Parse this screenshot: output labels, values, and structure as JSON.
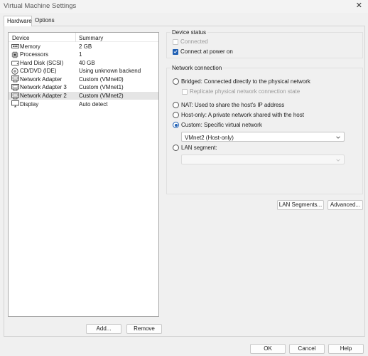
{
  "window": {
    "title": "Virtual Machine Settings",
    "close_glyph": "✕"
  },
  "tabs": [
    {
      "label": "Hardware",
      "active": true
    },
    {
      "label": "Options",
      "active": false
    }
  ],
  "device_list": {
    "headers": {
      "device": "Device",
      "summary": "Summary"
    },
    "rows": [
      {
        "icon": "memory-icon",
        "name": "Memory",
        "summary": "2 GB",
        "selected": false
      },
      {
        "icon": "processor-icon",
        "name": "Processors",
        "summary": "1",
        "selected": false
      },
      {
        "icon": "hard-disk-icon",
        "name": "Hard Disk (SCSI)",
        "summary": "40 GB",
        "selected": false
      },
      {
        "icon": "cd-dvd-icon",
        "name": "CD/DVD (IDE)",
        "summary": "Using unknown backend",
        "selected": false
      },
      {
        "icon": "network-adapter-icon",
        "name": "Network Adapter",
        "summary": "Custom (VMnet0)",
        "selected": false
      },
      {
        "icon": "network-adapter-icon",
        "name": "Network Adapter 3",
        "summary": "Custom (VMnet1)",
        "selected": false
      },
      {
        "icon": "network-adapter-icon",
        "name": "Network Adapter 2",
        "summary": "Custom (VMnet2)",
        "selected": true
      },
      {
        "icon": "display-icon",
        "name": "Display",
        "summary": "Auto detect",
        "selected": false
      }
    ],
    "add_label": "Add...",
    "remove_label": "Remove"
  },
  "device_status": {
    "title": "Device status",
    "connected": {
      "label": "Connected",
      "checked": false,
      "enabled": false
    },
    "connect_at_power_on": {
      "label": "Connect at power on",
      "checked": true,
      "enabled": true
    }
  },
  "network_connection": {
    "title": "Network connection",
    "bridged": {
      "label": "Bridged: Connected directly to the physical network",
      "selected": false
    },
    "replicate": {
      "label": "Replicate physical network connection state",
      "checked": false,
      "enabled": false
    },
    "nat": {
      "label": "NAT: Used to share the host's IP address",
      "selected": false
    },
    "host_only": {
      "label": "Host-only: A private network shared with the host",
      "selected": false
    },
    "custom": {
      "label": "Custom: Specific virtual network",
      "selected": true
    },
    "custom_select": {
      "value": "VMnet2 (Host-only)"
    },
    "lan_segment": {
      "label": "LAN segment:",
      "selected": false
    },
    "lan_select": {
      "value": ""
    }
  },
  "buttons": {
    "lan_segments": "LAN Segments...",
    "advanced": "Advanced...",
    "ok": "OK",
    "cancel": "Cancel",
    "help": "Help"
  },
  "colors": {
    "accent": "#1f5fb3",
    "selected_row": "#e5e5e5",
    "window_bg": "#f0f0f0"
  }
}
